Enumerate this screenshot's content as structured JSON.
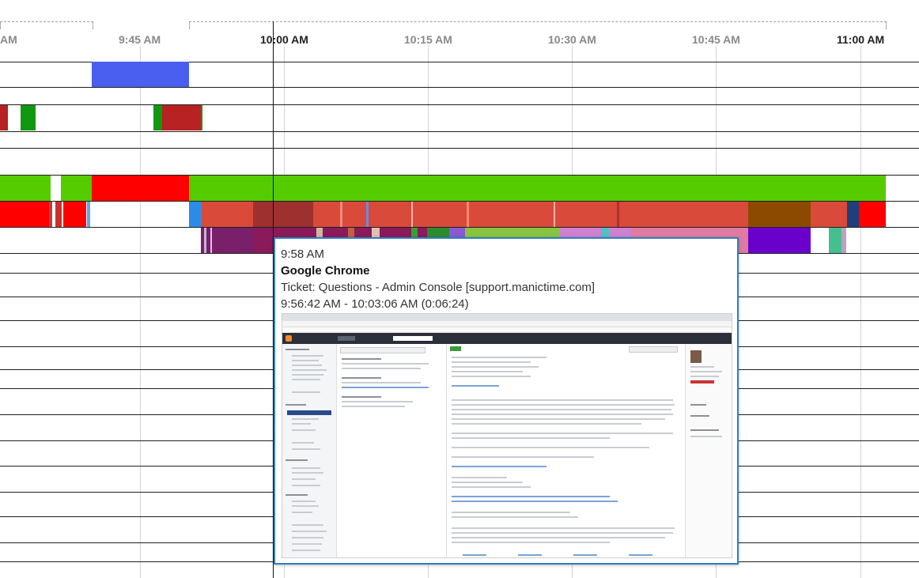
{
  "timeline": {
    "ticks": [
      {
        "label": "AM",
        "major": false
      },
      {
        "label": "9:45 AM",
        "major": false
      },
      {
        "label": "10:00 AM",
        "major": true
      },
      {
        "label": "10:15 AM",
        "major": false
      },
      {
        "label": "10:30 AM",
        "major": false
      },
      {
        "label": "10:45 AM",
        "major": false
      },
      {
        "label": "11:00 AM",
        "major": true
      }
    ]
  },
  "tooltip": {
    "time": "9:58 AM",
    "application": "Google Chrome",
    "document": "Ticket: Questions - Admin Console [support.manictime.com]",
    "range": "9:56:42 AM - 10:03:06 AM (0:06:24)"
  },
  "colors": {
    "accent_border": "#2f7ebf",
    "blue_block": "#4a5ff0",
    "active_green": "#55cc00",
    "red": "#ff0000",
    "dark_red": "#b82222",
    "brick": "#d94a3a",
    "brown": "#8b4a00",
    "purple": "#6a1b6a",
    "violet": "#6a00cc"
  }
}
